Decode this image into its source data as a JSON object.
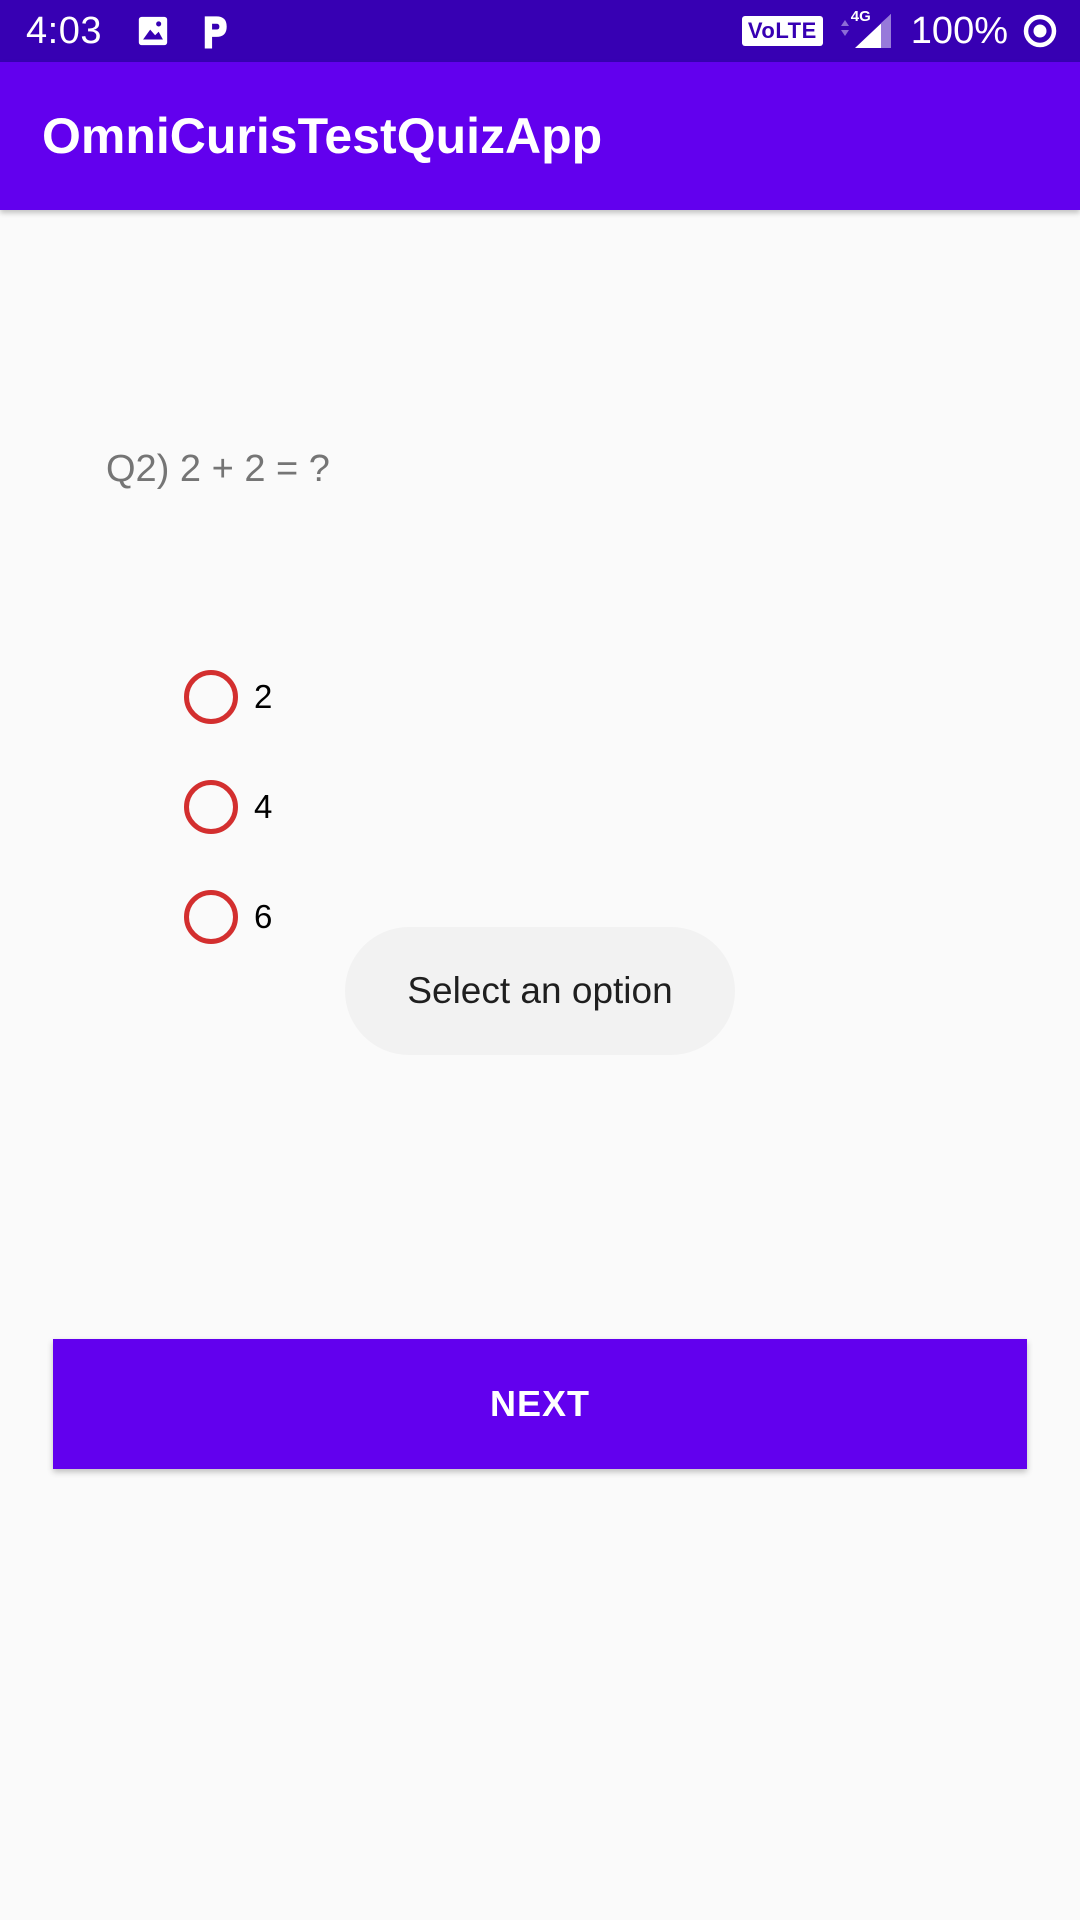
{
  "status_bar": {
    "time": "4:03",
    "volte": "VoLTE",
    "network": "4G",
    "battery": "100%",
    "icons": [
      "gallery-icon",
      "p-app-icon",
      "volte-icon",
      "signal-icon",
      "data-saver-icon"
    ]
  },
  "app_bar": {
    "title": "OmniCurisTestQuizApp"
  },
  "quiz": {
    "question": "Q2) 2 + 2 = ?",
    "options": [
      {
        "label": "2",
        "selected": false
      },
      {
        "label": "4",
        "selected": false
      },
      {
        "label": "6",
        "selected": false
      }
    ]
  },
  "toast": {
    "message": "Select an option"
  },
  "actions": {
    "next_label": "NEXT"
  },
  "colors": {
    "status_bar": "#3700b3",
    "primary": "#6200ee",
    "radio_accent": "#d32f2f",
    "background": "#fafafa",
    "toast_bg": "#f2f2f2"
  }
}
